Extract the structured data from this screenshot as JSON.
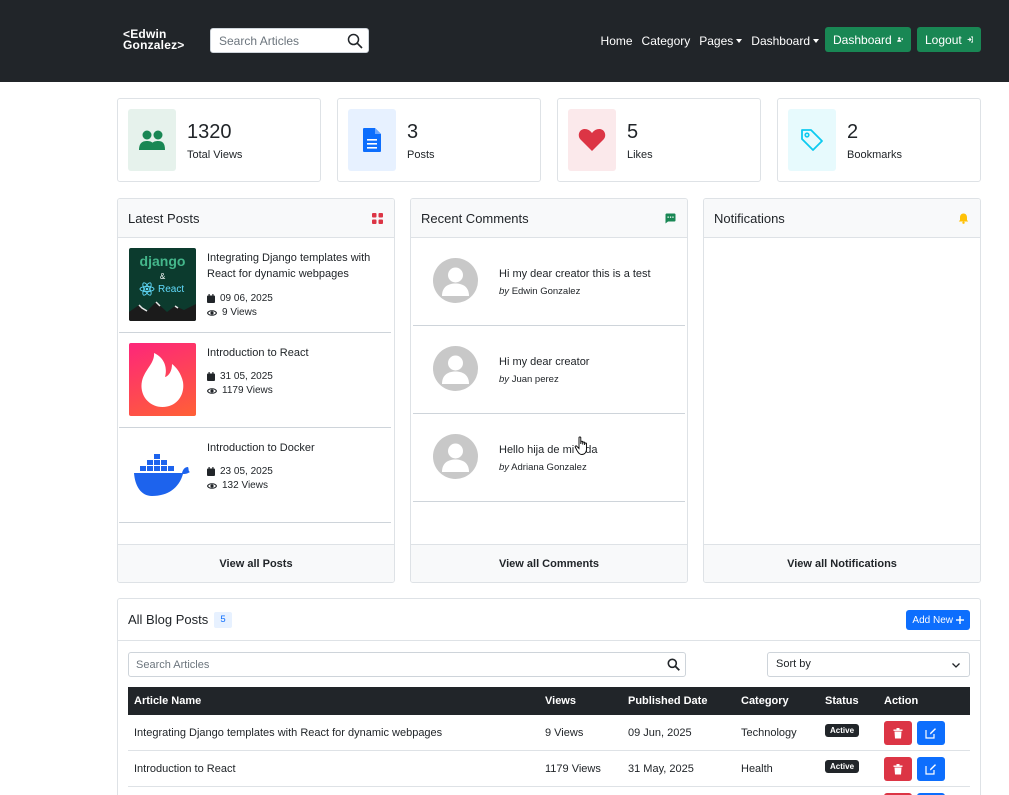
{
  "brand": {
    "line1": "<Edwin",
    "line2": "Gonzalez>"
  },
  "search": {
    "placeholder": "Search Articles"
  },
  "nav": {
    "home": "Home",
    "category": "Category",
    "pages": "Pages",
    "dashboard": "Dashboard",
    "dashboard_button": "Dashboard",
    "logout_button": "Logout"
  },
  "stats": [
    {
      "value": "1320",
      "label": "Total Views",
      "icon": "users-icon",
      "color": "#198754",
      "bg": "#e6f2ec"
    },
    {
      "value": "3",
      "label": "Posts",
      "icon": "document-icon",
      "color": "#0d6efd",
      "bg": "#e7f1ff"
    },
    {
      "value": "5",
      "label": "Likes",
      "icon": "heart-icon",
      "color": "#dc3545",
      "bg": "#fbe9eb"
    },
    {
      "value": "2",
      "label": "Bookmarks",
      "icon": "tag-icon",
      "color": "#0dcaf0",
      "bg": "#e7fafd"
    }
  ],
  "latest_posts": {
    "title": "Latest Posts",
    "footer": "View all Posts",
    "items": [
      {
        "title": "Integrating Django templates with React for dynamic webpages",
        "date": "09 06, 2025",
        "views": "9 Views",
        "thumb_text_1": "django",
        "thumb_text_2": "&",
        "thumb_text_3": "React"
      },
      {
        "title": "Introduction to React",
        "date": "31 05, 2025",
        "views": "1179 Views"
      },
      {
        "title": "Introduction to Docker",
        "date": "23 05, 2025",
        "views": "132 Views"
      }
    ]
  },
  "recent_comments": {
    "title": "Recent Comments",
    "footer": "View all Comments",
    "by_prefix": "by",
    "items": [
      {
        "text": "Hi my dear creator this is a test",
        "author": "Edwin Gonzalez"
      },
      {
        "text": "Hi my dear creator",
        "author": "Juan perez"
      },
      {
        "text": "Hello hija de mi vida",
        "author": "Adriana Gonzalez"
      }
    ]
  },
  "notifications": {
    "title": "Notifications",
    "footer": "View all Notifications"
  },
  "blog_posts": {
    "title": "All Blog Posts",
    "count": "5",
    "add_button": "Add New",
    "search_placeholder": "Search Articles",
    "sort_label": "Sort by",
    "columns": [
      "Article Name",
      "Views",
      "Published Date",
      "Category",
      "Status",
      "Action"
    ],
    "rows": [
      {
        "name": "Integrating Django templates with React for dynamic webpages",
        "views": "9 Views",
        "date": "09 Jun, 2025",
        "category": "Technology",
        "status": "Active"
      },
      {
        "name": "Introduction to React",
        "views": "1179 Views",
        "date": "31 May, 2025",
        "category": "Health",
        "status": "Active"
      }
    ]
  }
}
